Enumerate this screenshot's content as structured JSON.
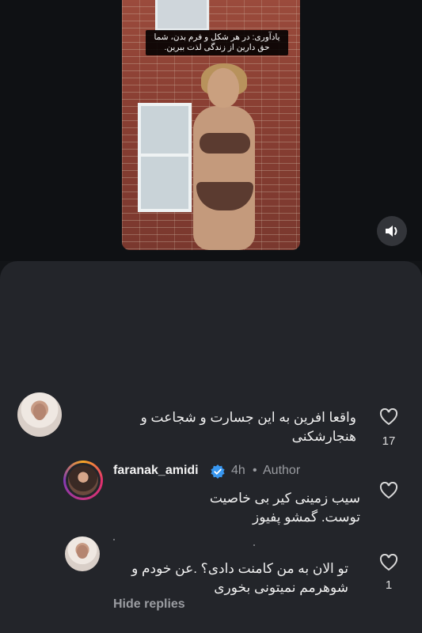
{
  "video": {
    "caption": "یادآوری: در هر شکل و فرم بدن، شما حق دارین از زندگی لذت ببرین.",
    "mute_icon": "speaker-icon"
  },
  "comments": [
    {
      "text": "واقعا افرین به این جسارت و شجاعت و هنجارشکنی",
      "likes": "17"
    },
    {
      "username": "faranak_amidi",
      "time": "4h",
      "separator": "•",
      "role": "Author",
      "text": "سیب زمینی کیر بی خاصیت توست. گمشو پفیوز"
    },
    {
      "text": "تو الان به من کامنت دادی؟ .عن خودم و شوهرمم نمیتونی بخوری",
      "likes": "1"
    }
  ],
  "hide_replies": "Hide replies",
  "colors": {
    "verified": "#3897f0",
    "sheet": "#23252a"
  }
}
